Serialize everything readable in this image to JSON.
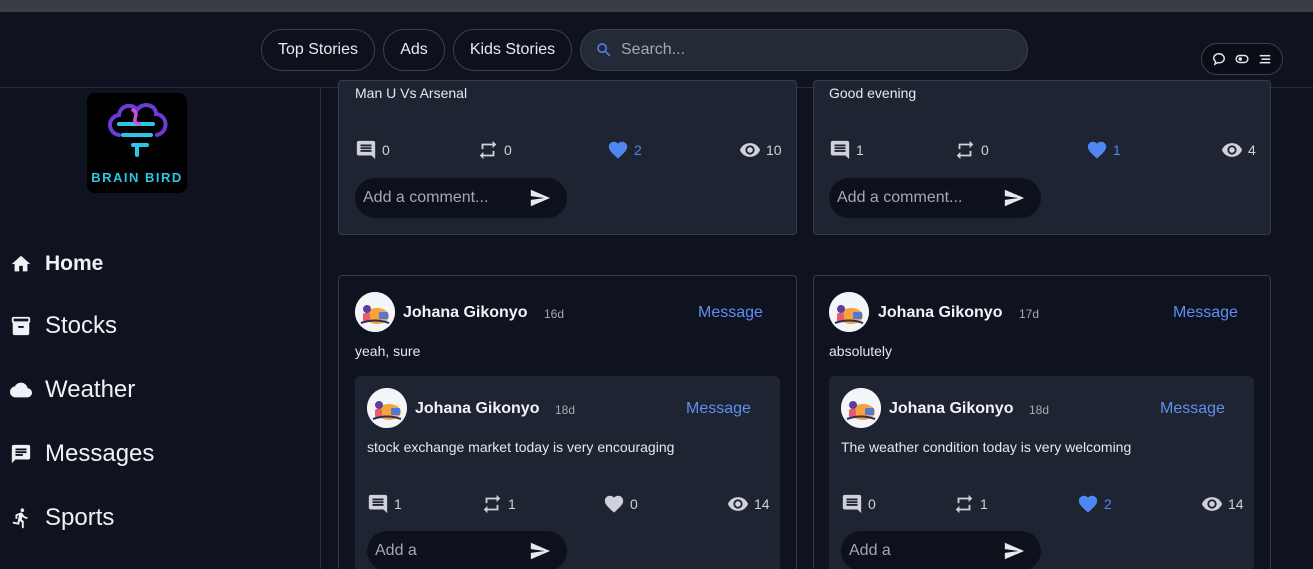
{
  "header": {
    "tabs": [
      "Top Stories",
      "Ads",
      "Kids Stories"
    ],
    "search_placeholder": "Search...",
    "action_icons": [
      "chat-bubble-icon",
      "toggle-icon",
      "menu-icon"
    ]
  },
  "sidebar": {
    "logo_text": "BRAIN BIRD",
    "items": [
      {
        "label": "Home",
        "icon": "home-icon",
        "active": true
      },
      {
        "label": "Stocks",
        "icon": "archive-icon"
      },
      {
        "label": "Weather",
        "icon": "cloud-icon"
      },
      {
        "label": "Messages",
        "icon": "message-icon"
      },
      {
        "label": "Sports",
        "icon": "running-icon"
      }
    ]
  },
  "feed": {
    "top_left": {
      "text": "Man U Vs Arsenal",
      "comments": "0",
      "reposts": "0",
      "likes": "2",
      "views": "10",
      "liked": true,
      "comment_placeholder": "Add a comment..."
    },
    "top_right": {
      "text": "Good evening",
      "comments": "1",
      "reposts": "0",
      "likes": "1",
      "views": "4",
      "liked": true,
      "comment_placeholder": "Add a comment..."
    },
    "bottom_left": {
      "author": "Johana Gikonyo",
      "age": "16d",
      "message_label": "Message",
      "text": "yeah, sure",
      "quoted": {
        "author": "Johana Gikonyo",
        "age": "18d",
        "message_label": "Message",
        "text": "stock exchange market today is very encouraging",
        "comments": "1",
        "reposts": "1",
        "likes": "0",
        "views": "14",
        "liked": false,
        "comment_placeholder": "Add a"
      }
    },
    "bottom_right": {
      "author": "Johana Gikonyo",
      "age": "17d",
      "message_label": "Message",
      "text": "absolutely",
      "quoted": {
        "author": "Johana Gikonyo",
        "age": "18d",
        "message_label": "Message",
        "text": "The weather condition today is very welcoming",
        "comments": "0",
        "reposts": "1",
        "likes": "2",
        "views": "14",
        "liked": true,
        "comment_placeholder": "Add a"
      }
    }
  },
  "colors": {
    "background": "#0f1320",
    "card": "#1f2432",
    "accent": "#4f86f0",
    "logo_text": "#2ec6e6"
  }
}
